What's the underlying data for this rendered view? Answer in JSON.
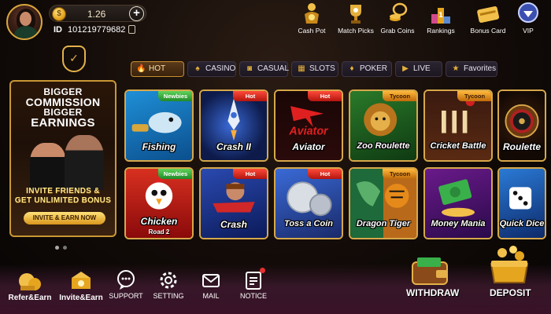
{
  "player": {
    "balance": "1.26",
    "coin_glyph": "$",
    "plus_glyph": "+",
    "id_label": "ID",
    "id_value": "101219779682"
  },
  "top_nav": [
    {
      "label": "Cash Pot",
      "icon": "cash-pot-icon"
    },
    {
      "label": "Match Picks",
      "icon": "trophy-icon"
    },
    {
      "label": "Grab Coins",
      "icon": "coins-icon"
    },
    {
      "label": "Rankings",
      "icon": "podium-icon"
    },
    {
      "label": "Bonus Card",
      "icon": "card-icon"
    },
    {
      "label": "VIP",
      "icon": "vip-badge-icon"
    }
  ],
  "promo": {
    "line1": "BIGGER",
    "line2": "COMMISSION",
    "line3": "BIGGER",
    "line4": "EARNINGS",
    "cta1": "INVITE FRIENDS &",
    "cta2": "GET UNLIMITED BONUS",
    "button": "INVITE & EARN NOW"
  },
  "tabs": [
    {
      "label": "HOT",
      "active": true,
      "icon": "flame-icon"
    },
    {
      "label": "CASINO",
      "active": false,
      "icon": "dealer-icon"
    },
    {
      "label": "CASUAL",
      "active": false,
      "icon": "gamepad-icon"
    },
    {
      "label": "SLOTS",
      "active": false,
      "icon": "slots-icon"
    },
    {
      "label": "POKER",
      "active": false,
      "icon": "cards-icon"
    },
    {
      "label": "LIVE",
      "active": false,
      "icon": "video-icon"
    },
    {
      "label": "Favorites",
      "active": false,
      "icon": "star-icon"
    }
  ],
  "games": [
    {
      "title": "Fishing",
      "subtitle": "",
      "badge": "Newbies"
    },
    {
      "title": "Crash II",
      "subtitle": "",
      "badge": "Hot"
    },
    {
      "title": "Aviator",
      "subtitle": "",
      "badge": "Hot"
    },
    {
      "title": "Zoo Roulette",
      "subtitle": "",
      "badge": "Tycoon"
    },
    {
      "title": "Cricket Battle",
      "subtitle": "",
      "badge": "Tycoon"
    },
    {
      "title": "Roulette",
      "subtitle": "",
      "badge": ""
    },
    {
      "title": "Chicken",
      "subtitle": "Road 2",
      "badge": "Newbies"
    },
    {
      "title": "Crash",
      "subtitle": "",
      "badge": "Hot"
    },
    {
      "title": "Toss a Coin",
      "subtitle": "",
      "badge": "Hot"
    },
    {
      "title": "Dragon Tiger",
      "subtitle": "",
      "badge": "Tycoon"
    },
    {
      "title": "Money Mania",
      "subtitle": "",
      "badge": ""
    },
    {
      "title": "Quick Dice",
      "subtitle": "",
      "badge": ""
    }
  ],
  "bottom_nav": [
    {
      "label": "Refer&Earn",
      "icon": "refer-earn-icon"
    },
    {
      "label": "Invite&Earn",
      "icon": "invite-earn-icon"
    },
    {
      "label": "SUPPORT",
      "icon": "support-chat-icon"
    },
    {
      "label": "SETTING",
      "icon": "gear-icon"
    },
    {
      "label": "MAIL",
      "icon": "mail-icon"
    },
    {
      "label": "NOTICE",
      "icon": "notice-icon"
    }
  ],
  "actions": {
    "withdraw": "WITHDRAW",
    "deposit": "DEPOSIT"
  },
  "colors": {
    "accent_gold": "#d7a84a",
    "hot_red": "#d0221a",
    "newbies_green": "#2fa83a",
    "tycoon_orange": "#e58a16"
  }
}
